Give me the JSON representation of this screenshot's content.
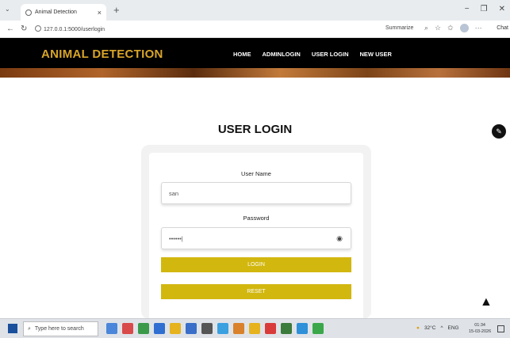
{
  "browser": {
    "tab_title": "Animal Detection",
    "tab_close": "×",
    "new_tab": "+",
    "url": "127.0.0.1:5000/userlogin",
    "summarize": "Summarize",
    "chat": "Chat",
    "window_controls": {
      "minimize": "−",
      "maximize": "❐",
      "close": "✕"
    }
  },
  "site": {
    "logo": "ANIMAL DETECTION",
    "nav": [
      "HOME",
      "ADMINLOGIN",
      "USER LOGIN",
      "NEW USER"
    ]
  },
  "login": {
    "title": "USER LOGIN",
    "username_label": "User Name",
    "username_value": "san",
    "password_label": "Password",
    "password_value": "••••••|",
    "login_button": "LOGIN",
    "reset_button": "RESET"
  },
  "taskbar": {
    "search_placeholder": "Type here to search",
    "temperature": "32°C",
    "language": "ENG",
    "time": "01:34",
    "date": "15-03-2026",
    "app_colors": [
      "#4a86d9",
      "#d94a4a",
      "#3a9a4a",
      "#2f6fd1",
      "#e6b31e",
      "#3a6ec8",
      "#555555",
      "#3aa0e0",
      "#d9822b",
      "#e6b31e",
      "#d93b3b",
      "#3a7a3a",
      "#2e90d8",
      "#3aa84a"
    ]
  },
  "colors": {
    "accent_button": "#d2b70f",
    "logo": "#d9a52a",
    "header_bg": "#000000"
  }
}
